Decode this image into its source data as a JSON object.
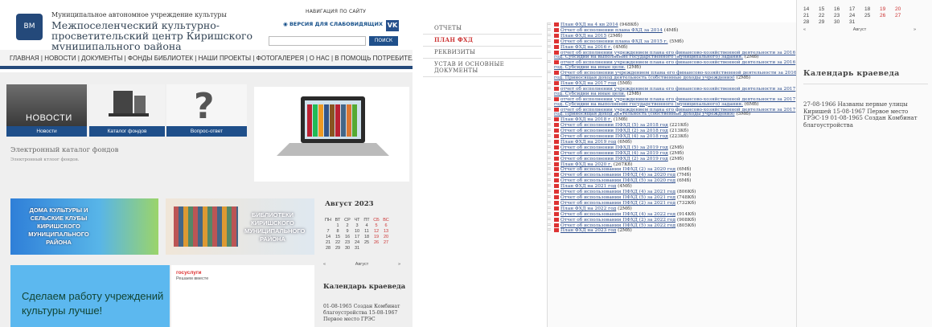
{
  "left": {
    "header": {
      "logo_text": "ВМ",
      "org_line1": "Муниципальное автономное учреждение культуры",
      "org_line2": "Межпоселенческий культурно-просветительский центр Киришского муниципального района",
      "nav_link": "НАВИГАЦИЯ ПО САЙТУ",
      "low_vision": "ВЕРСИЯ ДЛЯ СЛАБОВИДЯЩИХ",
      "vk": "VK",
      "search_button": "ПОИСК"
    },
    "main_nav": "ГЛАВНАЯ | НОВОСТИ | ДОКУМЕНТЫ | ФОНДЫ БИБЛИОТЕК | НАШИ ПРОЕКТЫ | ФОТОГАЛЕРЕЯ | О НАС | В ПОМОЩЬ ПОТРЕБИТЕЛЮ",
    "tiles": [
      {
        "caption": "Новости",
        "overlay": "НОВОСТИ"
      },
      {
        "caption": "Каталог фондов"
      },
      {
        "caption": "Вопрос-ответ",
        "overlay": "?"
      }
    ],
    "catalog": {
      "title": "Электронный каталог фондов",
      "subtitle": "Электронный ктлоог фондов."
    },
    "banner1": "ДОМА КУЛЬТУРЫ И СЕЛЬСКИЕ КЛУБЫ КИРИШСКОГО МУНИЦИПАЛЬНОГО РАЙОНА",
    "banner2": "БИБЛИОТЕКИ КИРИШСКОГО МУНИЦИПАЛЬНОГО РАЙОНА",
    "calendar": {
      "month": "Август 2023",
      "weekdays": [
        "ПН",
        "ВТ",
        "СР",
        "ЧТ",
        "ПТ",
        "СБ",
        "ВС"
      ],
      "weeks": [
        [
          "",
          "1",
          "2",
          "3",
          "4",
          "5",
          "6"
        ],
        [
          "7",
          "8",
          "9",
          "10",
          "11",
          "12",
          "13"
        ],
        [
          "14",
          "15",
          "16",
          "17",
          "18",
          "19",
          "20"
        ],
        [
          "21",
          "22",
          "23",
          "24",
          "25",
          "26",
          "27"
        ],
        [
          "28",
          "29",
          "30",
          "31",
          "",
          "",
          ""
        ]
      ],
      "prev": "«",
      "nav_month": "Август",
      "next": "»"
    },
    "gosuslugi": {
      "logo": "госуслуги",
      "tag": "Решаем вместе",
      "headline": "Сделаем работу учреждений культуры лучше!"
    },
    "kraeved": {
      "title": "Календарь краеведа",
      "text": "01-08-1965 Создан Комбинат благоустройства 15-08-1967 Первое место ГРЭС"
    }
  },
  "right": {
    "menu": [
      "ОТЧЕТЫ",
      "ПЛАН ФХД",
      "РЕКВИЗИТЫ",
      "УСТАВ И ОСНОВНЫЕ ДОКУМЕНТЫ"
    ],
    "active_menu": 1,
    "documents": [
      {
        "t": "План ФХД на 4 кв 2014",
        "s": "(948Кб)"
      },
      {
        "t": "Отчет об исполнении плана ФХД за 2014",
        "s": "(4Мб)"
      },
      {
        "t": "План ФХД на 2015",
        "s": "(2Мб)"
      },
      {
        "t": "Отчет об исполнении плана ФХД за 2015 г.",
        "s": "(5Мб)"
      },
      {
        "t": "План ФХД на 2016 г.",
        "s": "(4Мб)"
      },
      {
        "t": "отчет об исполнении учреждением плана его финансово-хозяйственной деятельности за 2016 год. Субсидии на выполнение государственного (муниципального) задания.",
        "s": "(2Мб)"
      },
      {
        "t": "отчет об исполнении учреждением плана его финансово-хозяйственной деятельности за 2016 год. Субсидии на иные цели.",
        "s": "(2Мб)"
      },
      {
        "t": "Отчет об исполнении учреждением плана его финансово-хозяйственной деятельности за 2016 год. Приносящая доход деятельность (собственные доходы учреждения)",
        "s": "(2Мб)"
      },
      {
        "t": "План ФХД на 2017 год",
        "s": "(5Мб)"
      },
      {
        "t": "отчет об исполнении учреждением плана его финансово-хозяйственной деятельности за 2017 год. Субсидии на иные цели.",
        "s": "(2Мб)"
      },
      {
        "t": "отчет об исполнении учреждением плана его финансово-хозяйственной деятельности за 2017 год. Субсидии на выполнение государственного (муниципального) задания.",
        "s": "(6Мб)"
      },
      {
        "t": "отчет об исполнении учреждением плана его финансово-хозяйственной деятельности за 2017 год. Приносящая доход деятельность (собственные доходы учреждения)",
        "s": "(5Мб)"
      },
      {
        "t": "План ФХД на 2018 г.",
        "s": "(1Мб)"
      },
      {
        "t": "Отчет об исполнении ПФХД (5) за 2018 год",
        "s": "(221Кб)"
      },
      {
        "t": "Отчет об исполнении ПФХД (2) за 2018 год",
        "s": "(213Кб)"
      },
      {
        "t": "Отчет об исполнении ПФХД (4) за 2018 год",
        "s": "(223Кб)"
      },
      {
        "t": "План ФХД на 2019 год",
        "s": "(6Мб)"
      },
      {
        "t": "Отчет об исполнении ПФХД (5) за 2019 год",
        "s": "(2Мб)"
      },
      {
        "t": "Отчет об исполнении ПФХД (4) за 2019 год",
        "s": "(2Мб)"
      },
      {
        "t": "Отчет об исполнении ПФХД (2) за 2019 год",
        "s": "(2Мб)"
      },
      {
        "t": "План ФХД на 2020 г.",
        "s": "(267Кб)"
      },
      {
        "t": "Отчет об использовании ПФХД (2) за 2020 год",
        "s": "(6Мб)"
      },
      {
        "t": "Отчет об использовании ПФХД (4) за 2020 год",
        "s": "(7Мб)"
      },
      {
        "t": "Отчет об использовании ПФХД (5) за 2020 год",
        "s": "(6Мб)"
      },
      {
        "t": "План ФХД на 2021 год",
        "s": "(4Мб)"
      },
      {
        "t": "Отчет об использовании ПФХД (4) за 2021 год",
        "s": "(806Кб)"
      },
      {
        "t": "Отчет об использовании ПФХД (5) за 2021 год",
        "s": "(748Кб)"
      },
      {
        "t": "Отчет об использовании ПФХД (2) за 2021 год",
        "s": "(732Кб)"
      },
      {
        "t": "План ФХД на 2022 год",
        "s": "(2Мб)"
      },
      {
        "t": "Отчет об использовании ПФХД (4) за 2022 год",
        "s": "(914Кб)"
      },
      {
        "t": "Отчет об использовании ПФХД (2) за 2022 год",
        "s": "(908Кб)"
      },
      {
        "t": "Отчет об использовании ПФХД (5) за 2022 год",
        "s": "(805Кб)"
      },
      {
        "t": "План ФХД на 2023 год",
        "s": "(2Мб)"
      }
    ],
    "calendar": {
      "weeks": [
        [
          "14",
          "15",
          "16",
          "17",
          "18",
          "19",
          "20"
        ],
        [
          "21",
          "22",
          "23",
          "24",
          "25",
          "26",
          "27"
        ],
        [
          "28",
          "29",
          "30",
          "31",
          "",
          "",
          ""
        ]
      ],
      "prev": "«",
      "nav_month": "Август",
      "next": "»"
    },
    "kraeved": {
      "title": "Календарь краеведа",
      "text": "27-08-1966 Названы первые улицы Киришей 15-08-1967 Первое место ГРЭС-19 01-08-1965 Создан Комбинат благоустройства"
    }
  }
}
